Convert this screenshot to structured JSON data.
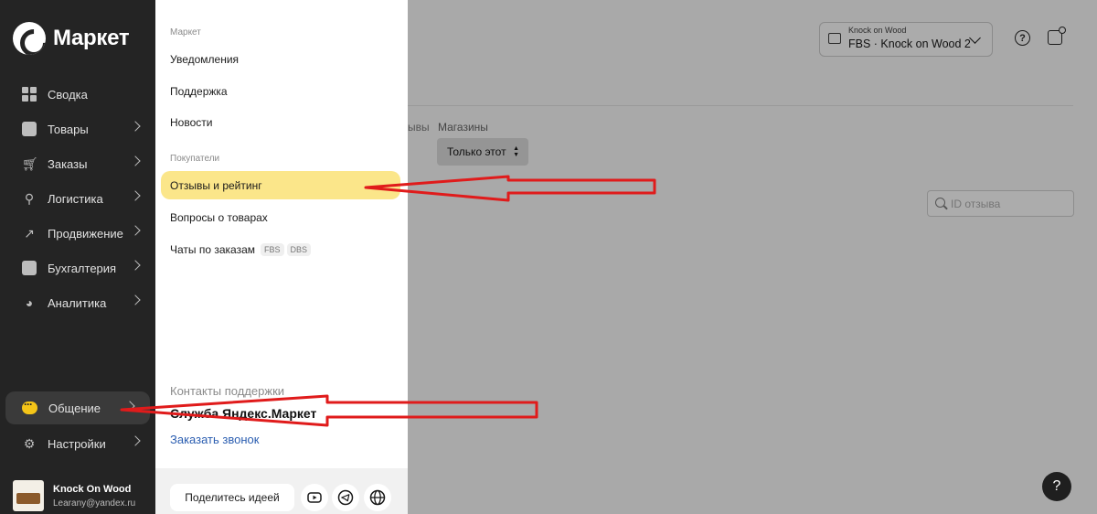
{
  "brand": {
    "name": "Маркет"
  },
  "sidebar": {
    "items": [
      {
        "label": "Сводка",
        "icon": "dashboard-icon",
        "has_chevron": false
      },
      {
        "label": "Товары",
        "icon": "box-icon",
        "has_chevron": true
      },
      {
        "label": "Заказы",
        "icon": "cart-icon",
        "has_chevron": true
      },
      {
        "label": "Логистика",
        "icon": "logistics-icon",
        "has_chevron": true
      },
      {
        "label": "Продвижение",
        "icon": "trend-icon",
        "has_chevron": true
      },
      {
        "label": "Бухгалтерия",
        "icon": "wallet-icon",
        "has_chevron": true
      },
      {
        "label": "Аналитика",
        "icon": "pie-chart-icon",
        "has_chevron": true
      }
    ],
    "bottom_items": [
      {
        "label": "Общение",
        "icon": "chat-icon",
        "active": true
      },
      {
        "label": "Настройки",
        "icon": "gear-icon",
        "active": false
      }
    ],
    "profile": {
      "name": "Knock On Wood",
      "email": "Learany@yandex.ru"
    }
  },
  "flyout": {
    "section_market": "Маркет",
    "market_links": [
      "Уведомления",
      "Поддержка",
      "Новости"
    ],
    "section_buyers": "Покупатели",
    "buyer_links": {
      "reviews": "Отзывы и рейтинг",
      "questions": "Вопросы о товарах",
      "chats": "Чаты по заказам",
      "chats_tags": [
        "FBS",
        "DBS"
      ]
    },
    "support": {
      "title": "Контакты поддержки",
      "service": "Служба Яндекс.Маркет",
      "call": "Заказать звонок"
    },
    "footer": {
      "idea_button": "Поделитесь идеей",
      "icons": [
        "youtube-icon",
        "telegram-icon",
        "globe-icon"
      ]
    }
  },
  "header": {
    "store_small": "Knock on Wood",
    "store_main": "FBS · Knock on Wood 2"
  },
  "main": {
    "tab_fragment": "ывы",
    "shops_label": "Магазины",
    "shops_value": "Только этот",
    "search_placeholder": "ID отзыва"
  },
  "colors": {
    "highlight": "#fbe68a",
    "annotation_arrow": "#e01b1b",
    "sidebar_bg": "#242424",
    "accent": "#f5c518"
  }
}
